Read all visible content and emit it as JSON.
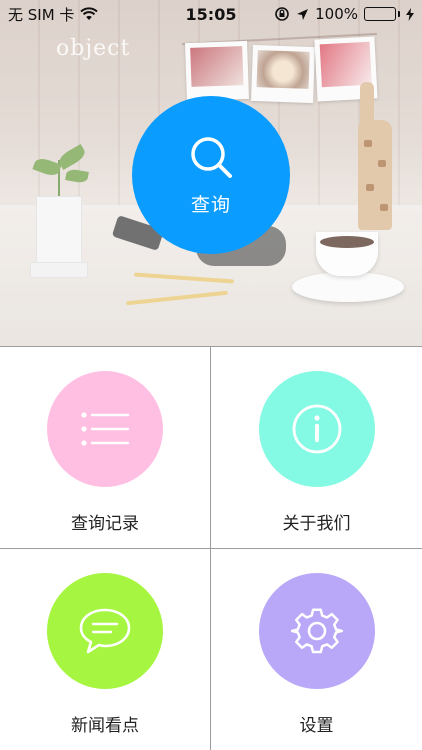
{
  "status_bar": {
    "carrier": "无 SIM 卡",
    "time": "15:05",
    "battery_percent": "100%",
    "battery_level": 1.0
  },
  "hero": {
    "brand_text": "object",
    "search_label": "查询"
  },
  "menu": [
    {
      "label": "查询记录",
      "icon": "list-icon",
      "color": "#ffbfe3"
    },
    {
      "label": "关于我们",
      "icon": "info-icon",
      "color": "#84f9e3"
    },
    {
      "label": "新闻看点",
      "icon": "chat-bubble-icon",
      "color": "#a6f540"
    },
    {
      "label": "设置",
      "icon": "gear-icon",
      "color": "#b9a8f8"
    }
  ],
  "colors": {
    "search_button": "#0a9cff",
    "divider": "#9c9c9c"
  }
}
